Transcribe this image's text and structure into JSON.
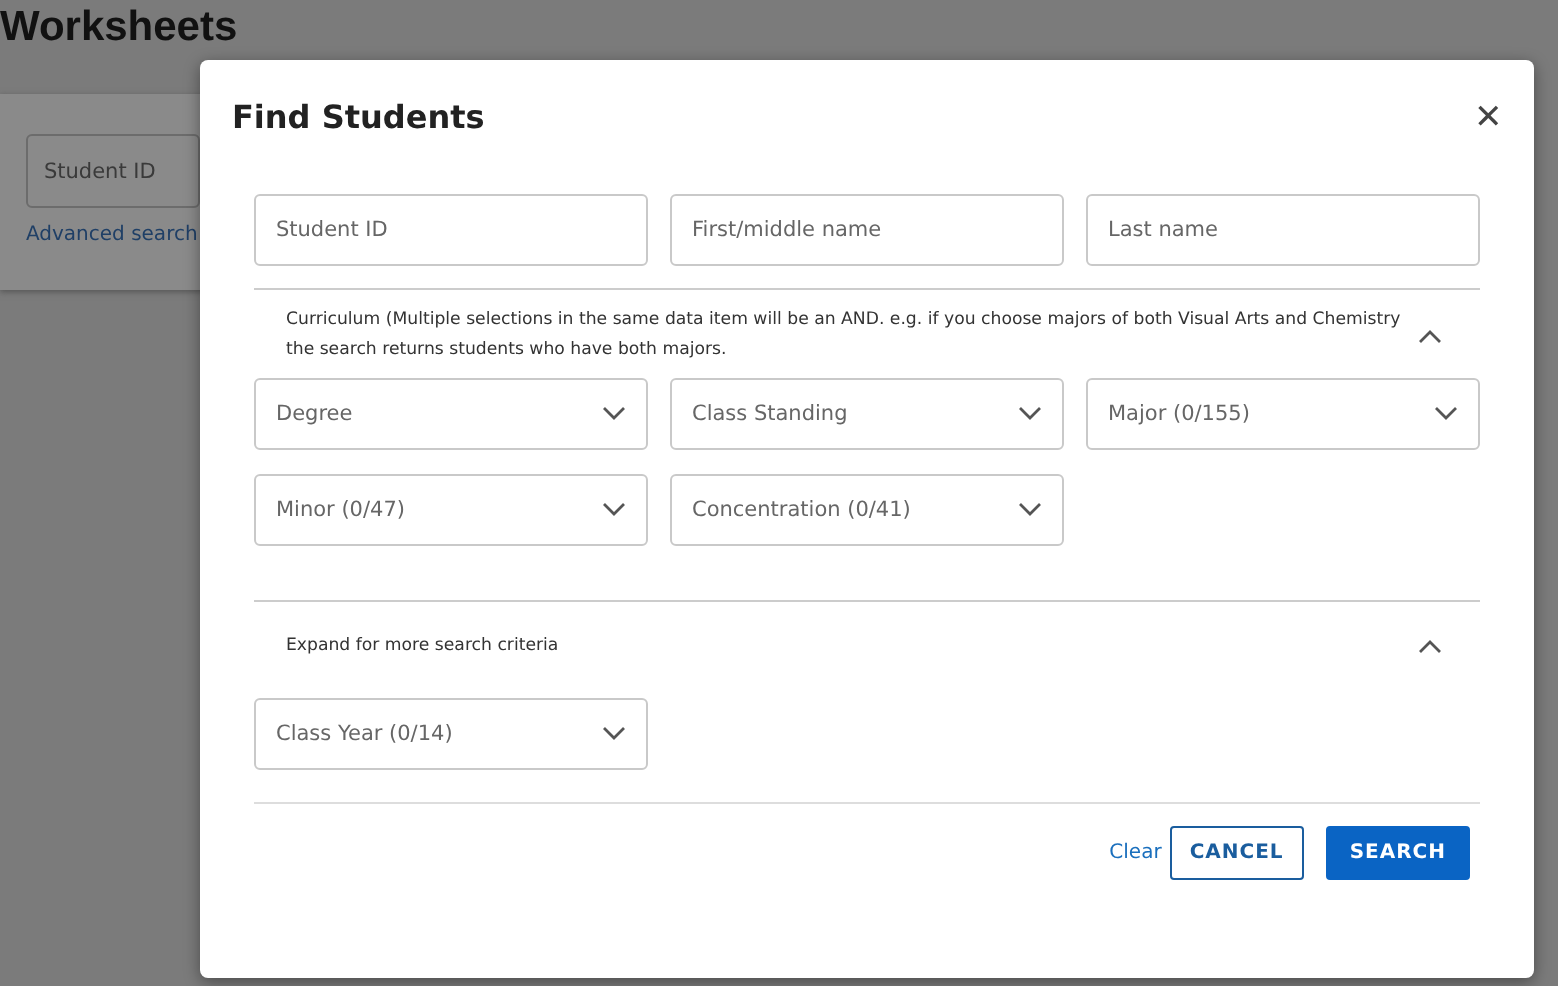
{
  "page": {
    "title": "Worksheets",
    "search_field": {
      "placeholder": "Student ID"
    },
    "advanced_link": "Advanced search"
  },
  "dialog": {
    "title": "Find Students",
    "close": "✕",
    "fields": [
      {
        "placeholder": "Student ID"
      },
      {
        "placeholder": "First/middle name"
      },
      {
        "placeholder": "Last name"
      }
    ],
    "sections": [
      {
        "heading": "Curriculum (Multiple selections in the same data item will be an AND. e.g. if you choose majors of both Visual Arts and Chemistry the search returns students who have both majors.",
        "expanded": true,
        "dropdowns": [
          "Degree",
          "Class Standing",
          "Major (0/155)",
          "Minor (0/47)",
          "Concentration (0/41)"
        ]
      },
      {
        "heading": "Expand for more search criteria",
        "expanded": true,
        "dropdowns": [
          "Class Year (0/14)"
        ]
      }
    ],
    "buttons": [
      {
        "kind": "link",
        "label": "Clear"
      },
      {
        "kind": "outline",
        "label": "CANCEL"
      },
      {
        "kind": "primary",
        "label": "SEARCH"
      }
    ]
  }
}
